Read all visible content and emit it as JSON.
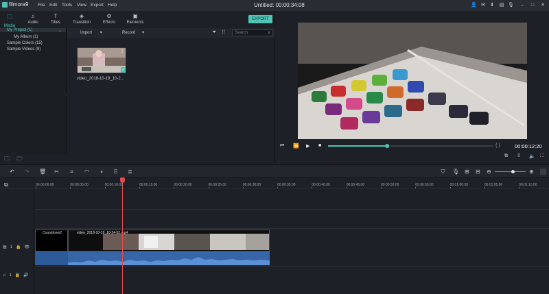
{
  "app": {
    "name": "filmora9",
    "title": "Untitled:",
    "title_time": "00:00:34:08",
    "menu": [
      "File",
      "Edit",
      "Tools",
      "View",
      "Export",
      "Help"
    ]
  },
  "media_tabs": [
    {
      "label": "Media",
      "icon": "folder-icon",
      "glyph": "🗀"
    },
    {
      "label": "Audio",
      "icon": "music-note-icon",
      "glyph": "♫"
    },
    {
      "label": "Titles",
      "icon": "titles-icon",
      "glyph": "T"
    },
    {
      "label": "Transition",
      "icon": "transition-icon",
      "glyph": "◈"
    },
    {
      "label": "Effects",
      "icon": "effects-icon",
      "glyph": "⚙"
    },
    {
      "label": "Elements",
      "icon": "elements-icon",
      "glyph": "▣"
    }
  ],
  "export_label": "EXPORT",
  "tree": {
    "project": "My Project (1)",
    "album": "My Album (1)",
    "sample_colors": "Sample Colors (15)",
    "sample_videos": "Sample Videos (9)"
  },
  "subbar": {
    "import_label": "Import",
    "record_label": "Record",
    "search_placeholder": "Search"
  },
  "media_item": {
    "caption": "video_2018-10-19_10-2..."
  },
  "preview": {
    "timecode": "00:00:12:20",
    "progress": 0.36,
    "brackets": "{ }"
  },
  "ruler_ticks": [
    "00:00:00:00",
    "00:00:05:00",
    "00:00:10:00",
    "00:00:15:00",
    "00:00:20:00",
    "00:00:25:00",
    "00:00:30:00",
    "00:00:35:00",
    "00:00:40:00",
    "00:00:45:00",
    "00:00:50:00",
    "00:00:55:00",
    "00:01:00:00",
    "00:01:05:00",
    "00:01:10:00"
  ],
  "tracks": {
    "video_track_number": "1",
    "audio_track_number": "1",
    "title_clip_label": "Countdown2",
    "video_clip_label": "video_2018-10-19_10-24-52.mp4"
  },
  "colors": {
    "accent": "#4fc3b4",
    "playhead": "#e04d4d",
    "audio_clip": "#3766a8"
  }
}
